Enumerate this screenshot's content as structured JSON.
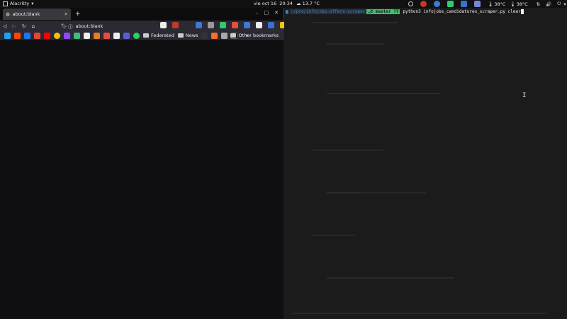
{
  "topbar": {
    "app_name": "Alacritty",
    "clock": "vie oct 16  20:34",
    "weather": "13.7 °C",
    "temp1": "38°C",
    "temp2": "38°C"
  },
  "browser": {
    "tab_title": "about:blank",
    "new_tab": "+",
    "url": "about:blank",
    "bookmark_folders": [
      "Federated",
      "News"
    ],
    "other_bookmarks": "Other bookmarks",
    "overflow": "»"
  },
  "terminal": {
    "path": "~/pro/infojobs-offers-scraper",
    "git": "master ?7",
    "command": "python3 infojobs_candidatures_scraper.py clear"
  },
  "colors": {
    "accent_green": "#3ac46b",
    "terminal_bg": "#1b1b1b"
  }
}
